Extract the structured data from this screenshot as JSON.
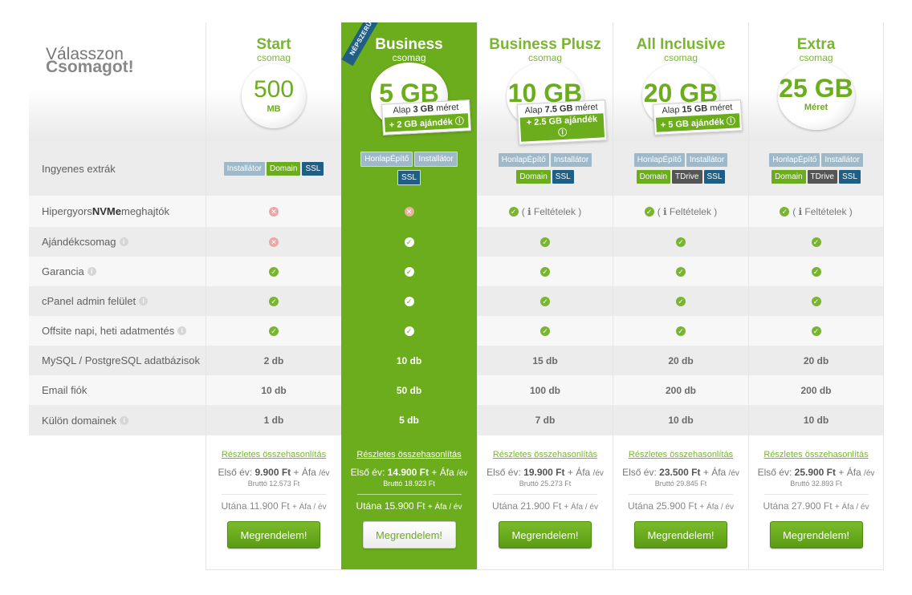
{
  "heading": {
    "line1": "Válasszon",
    "line2": "Csomagot!"
  },
  "features": [
    {
      "label_pre": "Ingyenes extrák",
      "label_bold": "",
      "label_post": "",
      "info": false
    },
    {
      "label_pre": "Hipergyors ",
      "label_bold": "NVMe",
      "label_post": " meghajtók",
      "info": false
    },
    {
      "label_pre": "Ajándékcsomag",
      "label_bold": "",
      "label_post": "",
      "info": true
    },
    {
      "label_pre": "Garancia",
      "label_bold": "",
      "label_post": "",
      "info": true
    },
    {
      "label_pre": "cPanel admin felület",
      "label_bold": "",
      "label_post": "",
      "info": true
    },
    {
      "label_pre": "Offsite napi, heti adatmentés",
      "label_bold": "",
      "label_post": "",
      "info": true
    },
    {
      "label_pre": "MySQL / PostgreSQL adatbázisok",
      "label_bold": "",
      "label_post": "",
      "info": false
    },
    {
      "label_pre": "Email fiók",
      "label_bold": "",
      "label_post": "",
      "info": false
    },
    {
      "label_pre": "Külön domainek",
      "label_bold": "",
      "label_post": "",
      "info": true
    }
  ],
  "info_glyph": "i",
  "check_glyph": "✓",
  "cross_glyph": "✕",
  "conditions_label": "( ℹ Feltételek )",
  "compare_link": "Részletes összehasonlítás",
  "first_year_label": "Első év:",
  "vat_label": "+ Áfa",
  "per_year": "/év",
  "after_label": "Utána",
  "per_year_after": "+ Áfa / év",
  "order_button": "Megrendelem!",
  "popular_badge": "NÉPSZERŰ",
  "bonus_base_pre": "Alap",
  "bonus_base_post": "méret",
  "plans": [
    {
      "name": "Start",
      "sub": "csomag",
      "disk_value": "500",
      "disk_unit": "MB",
      "featured": false,
      "bonus_base": "",
      "bonus_gift": "",
      "extras": [
        [
          "Installátor",
          "grey"
        ],
        [
          "Domain",
          "green"
        ],
        [
          "SSL",
          "navy"
        ]
      ],
      "nvme": "cross",
      "gift": "cross",
      "guarantee": "check",
      "cpanel": "check",
      "backup": "check",
      "db": "2 db",
      "email": "10 db",
      "domains": "1 db",
      "first_year": "9.900 Ft",
      "gross": "Bruttó 12.573 Ft",
      "after": "11.900 Ft"
    },
    {
      "name": "Business",
      "sub": "csomag",
      "disk_value": "5 GB",
      "disk_unit": "",
      "featured": true,
      "bonus_base": "3 GB",
      "bonus_gift": "+ 2 GB ajándék ⓘ",
      "extras": [
        [
          "HonlapÉpítő",
          "grey"
        ],
        [
          "Installátor",
          "grey"
        ],
        [
          "SSL",
          "navy"
        ]
      ],
      "nvme": "cross",
      "gift": "check",
      "guarantee": "check",
      "cpanel": "check",
      "backup": "check",
      "db": "10 db",
      "email": "50 db",
      "domains": "5 db",
      "first_year": "14.900 Ft",
      "gross": "Bruttó 18.923 Ft",
      "after": "15.900 Ft"
    },
    {
      "name": "Business Plusz",
      "sub": "csomag",
      "disk_value": "10 GB",
      "disk_unit": "",
      "featured": false,
      "bonus_base": "7.5 GB",
      "bonus_gift": "+ 2.5 GB ajándék ⓘ",
      "extras": [
        [
          "HonlapÉpítő",
          "grey"
        ],
        [
          "Installátor",
          "grey"
        ],
        [
          "Domain",
          "green"
        ],
        [
          "SSL",
          "navy"
        ]
      ],
      "nvme": "cond",
      "gift": "check",
      "guarantee": "check",
      "cpanel": "check",
      "backup": "check",
      "db": "15 db",
      "email": "100 db",
      "domains": "7 db",
      "first_year": "19.900 Ft",
      "gross": "Bruttó 25.273 Ft",
      "after": "21.900 Ft"
    },
    {
      "name": "All Inclusive",
      "sub": "csomag",
      "disk_value": "20 GB",
      "disk_unit": "",
      "featured": false,
      "bonus_base": "15 GB",
      "bonus_gift": "+ 5 GB ajándék ⓘ",
      "extras": [
        [
          "HonlapÉpítő",
          "grey"
        ],
        [
          "Installátor",
          "grey"
        ],
        [
          "Domain",
          "green"
        ],
        [
          "TDrive",
          "dark"
        ],
        [
          "SSL",
          "navy"
        ]
      ],
      "nvme": "cond",
      "gift": "check",
      "guarantee": "check",
      "cpanel": "check",
      "backup": "check",
      "db": "20 db",
      "email": "200 db",
      "domains": "10 db",
      "first_year": "23.500 Ft",
      "gross": "Bruttó 29.845 Ft",
      "after": "25.900 Ft"
    },
    {
      "name": "Extra",
      "sub": "csomag",
      "disk_value": "25 GB",
      "disk_unit": "Méret",
      "featured": false,
      "bonus_base": "",
      "bonus_gift": "",
      "extras": [
        [
          "HonlapÉpítő",
          "grey"
        ],
        [
          "Installátor",
          "grey"
        ],
        [
          "Domain",
          "green"
        ],
        [
          "TDrive",
          "dark"
        ],
        [
          "SSL",
          "navy"
        ]
      ],
      "nvme": "cond",
      "gift": "check",
      "guarantee": "check",
      "cpanel": "check",
      "backup": "check",
      "db": "20 db",
      "email": "200 db",
      "domains": "10 db",
      "first_year": "25.900 Ft",
      "gross": "Bruttó 32.893 Ft",
      "after": "27.900 Ft"
    }
  ],
  "colors": {
    "accent": "#6cad1d",
    "navy": "#1f5e85",
    "tag_grey": "#9eb9c9",
    "cross": "#e9a8a8"
  }
}
